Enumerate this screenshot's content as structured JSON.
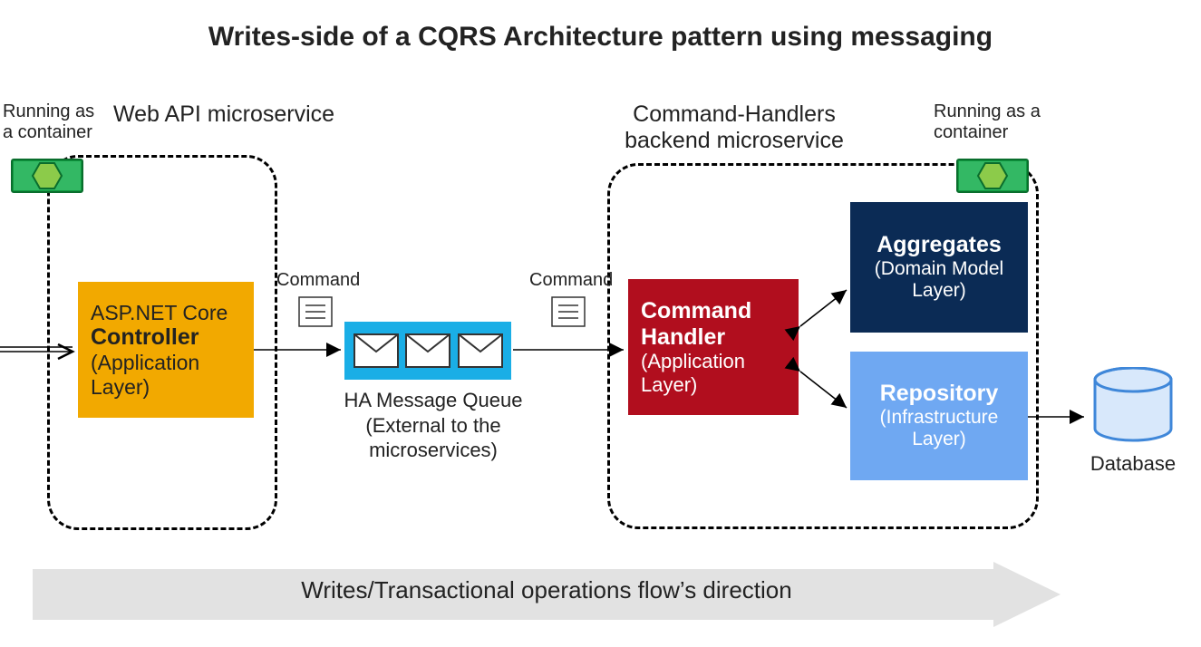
{
  "title": "Writes-side of a CQRS Architecture pattern using messaging",
  "container_label": "Running as a container",
  "web_api_section": "Web API microservice",
  "backend_section": "Command-Handlers backend microservice",
  "controller": {
    "line1": "ASP.NET Core",
    "bold": "Controller",
    "sub": "(Application Layer)"
  },
  "command_handler": {
    "bold": "Command Handler",
    "sub": "(Application Layer)"
  },
  "aggregates": {
    "bold": "Aggregates",
    "sub": "(Domain Model Layer)"
  },
  "repository": {
    "bold": "Repository",
    "sub": "(Infrastructure Layer)"
  },
  "command_note": "Command",
  "queue_caption_line1": "HA Message Queue",
  "queue_caption_line2": "(External to the microservices)",
  "database_label": "Database",
  "flow_direction": "Writes/Transactional operations flow’s direction",
  "colors": {
    "orange": "#F2A900",
    "red": "#B10E1E",
    "navy": "#0B2B55",
    "lightblue": "#6FA8F2",
    "queue": "#1AAEE6",
    "arrowbar": "#E2E2E2",
    "db": "#3F87D9",
    "container_out": "#0E9A3F",
    "container_in": "#8CCB4A"
  }
}
